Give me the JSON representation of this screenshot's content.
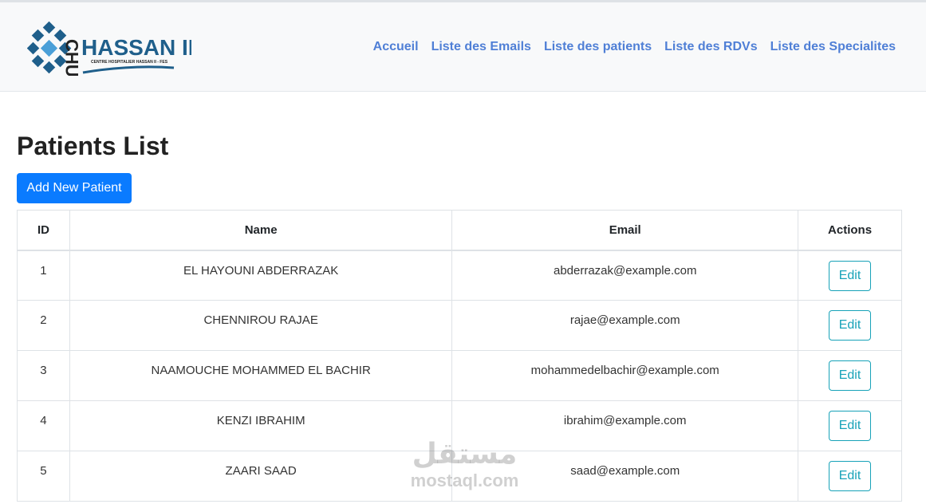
{
  "brand": {
    "logo_letters": "CHU",
    "logo_name": "HASSAN II",
    "logo_subtitle": "CENTRE HOSPITALIER HASSAN II - FES"
  },
  "nav": {
    "items": [
      {
        "label": "Accueil"
      },
      {
        "label": "Liste des Emails"
      },
      {
        "label": "Liste des patients"
      },
      {
        "label": "Liste des RDVs"
      },
      {
        "label": "Liste des Specialites"
      }
    ]
  },
  "main": {
    "title": "Patients List",
    "add_button": "Add New Patient",
    "columns": [
      "ID",
      "Name",
      "Email",
      "Actions"
    ],
    "rows": [
      {
        "id": "1",
        "name": "EL HAYOUNI ABDERRAZAK",
        "email": "abderrazak@example.com",
        "action": "Edit"
      },
      {
        "id": "2",
        "name": "CHENNIROU RAJAE",
        "email": "rajae@example.com",
        "action": "Edit"
      },
      {
        "id": "3",
        "name": "NAAMOUCHE MOHAMMED EL BACHIR",
        "email": "mohammedelbachir@example.com",
        "action": "Edit"
      },
      {
        "id": "4",
        "name": "KENZI IBRAHIM",
        "email": "ibrahim@example.com",
        "action": "Edit"
      },
      {
        "id": "5",
        "name": "ZAARI SAAD",
        "email": "saad@example.com",
        "action": "Edit"
      }
    ]
  },
  "watermark": {
    "arabic": "مستقل",
    "latin": "mostaql.com"
  },
  "colors": {
    "primary": "#0a7bff",
    "nav_link": "#4f7fd6",
    "edit": "#17a2b8",
    "logo_blue": "#1f5f8b"
  }
}
